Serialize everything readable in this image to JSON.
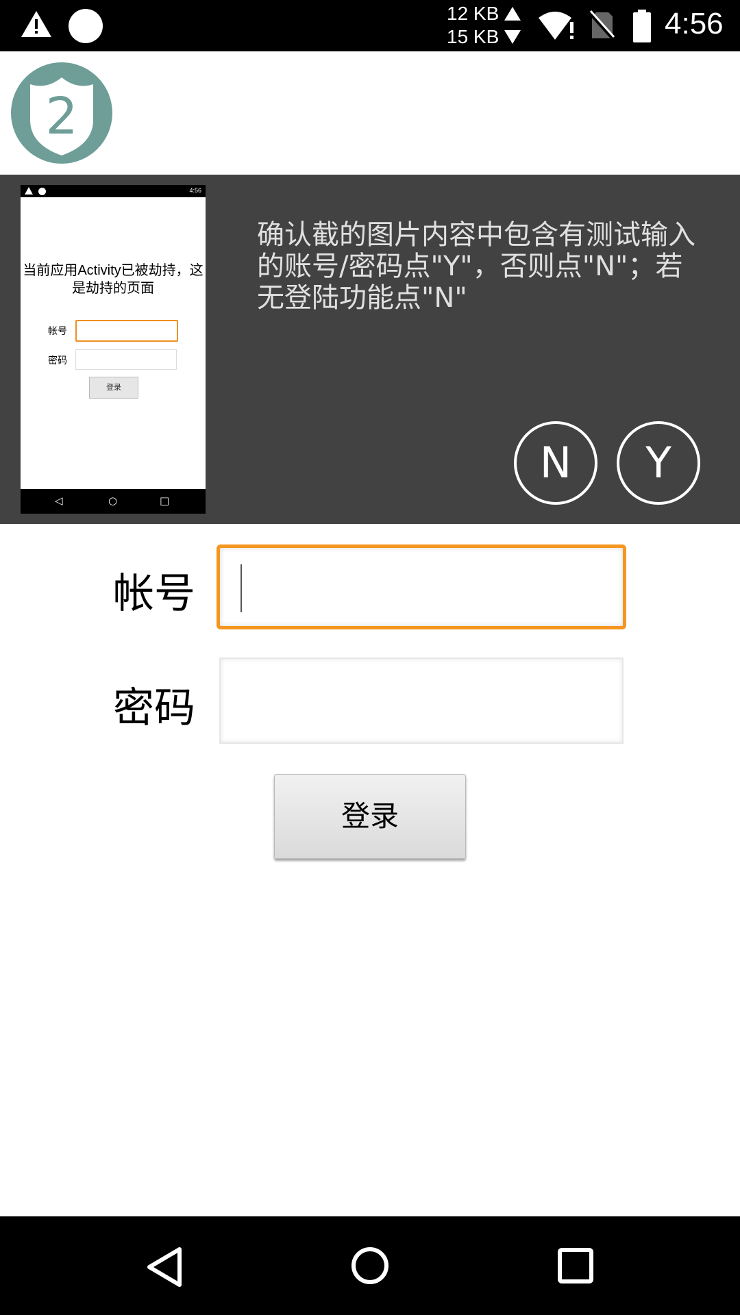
{
  "status_bar": {
    "net_up": "12 KB",
    "net_down": "15 KB",
    "time": "4:56",
    "icons": [
      "warning-icon",
      "circle-icon",
      "wifi-icon",
      "no-sim-icon",
      "battery-icon"
    ]
  },
  "header": {
    "logo_number": "2",
    "logo_color": "#6e9e97"
  },
  "panel": {
    "prompt": "确认截的图片内容中包含有测试输入的账号/密码点\"Y\"，否则点\"N\"；若无登陆功能点\"N\"",
    "button_n": "N",
    "button_y": "Y",
    "thumbnail": {
      "time": "4:56",
      "message": "当前应用Activity已被劫持，这是劫持的页面",
      "account_label": "帐号",
      "password_label": "密码",
      "login_label": "登录"
    }
  },
  "form": {
    "account_label": "帐号",
    "account_value": "",
    "password_label": "密码",
    "password_value": "",
    "login_button": "登录",
    "accent_color": "#f5961e"
  },
  "nav_bar": {
    "icons": [
      "back-icon",
      "home-icon",
      "recents-icon"
    ]
  }
}
